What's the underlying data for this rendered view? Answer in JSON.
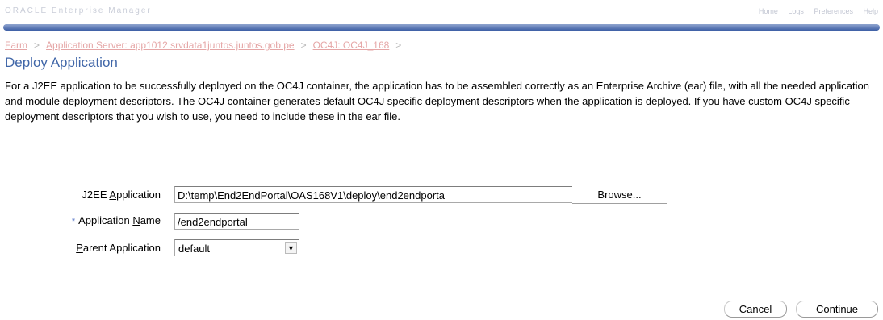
{
  "header": {
    "brand_faint": "ORACLE Enterprise Manager",
    "links": [
      "Home",
      "Logs",
      "Preferences",
      "Help"
    ]
  },
  "breadcrumb": {
    "items": [
      "Farm",
      "Application Server: app1012.srvdata1juntos.juntos.gob.pe",
      "OC4J: OC4J_168"
    ],
    "separator": ">"
  },
  "page": {
    "title": "Deploy Application",
    "description": "For a J2EE application to be successfully deployed on the OC4J container, the application has to be assembled correctly as an Enterprise Archive (ear) file, with all the needed application and module deployment descriptors. The OC4J container generates default OC4J specific deployment descriptors when the application is deployed. If you have custom OC4J specific deployment descriptors that you wish to use, you need to include these in the ear file."
  },
  "form": {
    "j2ee_label_pre": "J2EE ",
    "j2ee_label_acc": "A",
    "j2ee_label_post": "pplication",
    "j2ee_value": "D:\\temp\\End2EndPortal\\OAS168V1\\deploy\\end2endporta",
    "browse_label": "Browse...",
    "required_mark": "*",
    "appname_label_pre": "Application ",
    "appname_label_acc": "N",
    "appname_label_post": "ame",
    "appname_value": "/end2endportal",
    "parent_label_acc": "P",
    "parent_label_post": "arent Application",
    "parent_value": "default",
    "select_arrow_icon": "chevron-down-icon"
  },
  "actions": {
    "cancel_acc": "C",
    "cancel_post": "ancel",
    "continue_pre": "C",
    "continue_acc": "o",
    "continue_post": "ntinue"
  },
  "colors": {
    "accent_blue": "#4066a8",
    "bar_blue": "#3d5fa5",
    "breadcrumb_link": "#e5a6a6",
    "required_star": "#5a78c8"
  }
}
